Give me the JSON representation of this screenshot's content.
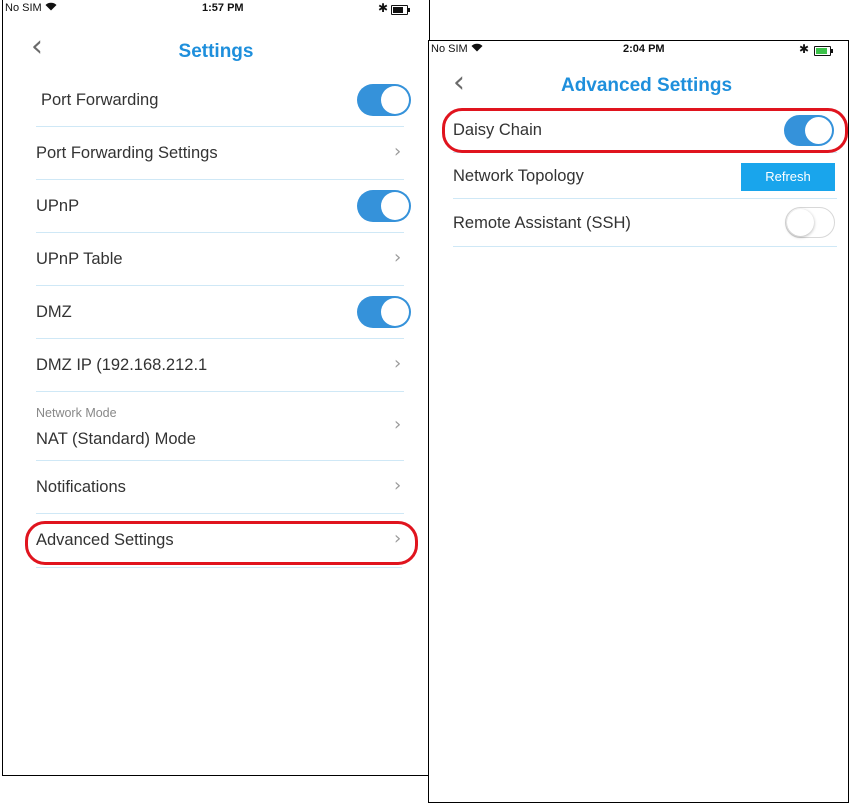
{
  "left": {
    "status": {
      "carrier": "No SIM",
      "time": "1:57 PM"
    },
    "title": "Settings",
    "rows": [
      {
        "label": "Port Forwarding"
      },
      {
        "label": "Port Forwarding Settings"
      },
      {
        "label": "UPnP"
      },
      {
        "label": "UPnP Table"
      },
      {
        "label": "DMZ"
      },
      {
        "label": "DMZ IP (192.168.212.1"
      },
      {
        "sub": "Network Mode",
        "label": "NAT (Standard) Mode"
      },
      {
        "label": "Notifications"
      },
      {
        "label": "Advanced Settings"
      }
    ]
  },
  "right": {
    "status": {
      "carrier": "No SIM",
      "time": "2:04 PM"
    },
    "title": "Advanced Settings",
    "rows": [
      {
        "label": "Daisy Chain"
      },
      {
        "label": "Network Topology",
        "button": "Refresh"
      },
      {
        "label": "Remote Assistant (SSH)"
      }
    ]
  },
  "icons": {
    "wifi": "ὭC",
    "bluetooth": "✱",
    "back": "❮",
    "chevron": "›"
  },
  "colors": {
    "accent": "#1e8fdc",
    "toggle_on": "#3592da",
    "highlight": "#e0141e",
    "button": "#19a5ec"
  }
}
